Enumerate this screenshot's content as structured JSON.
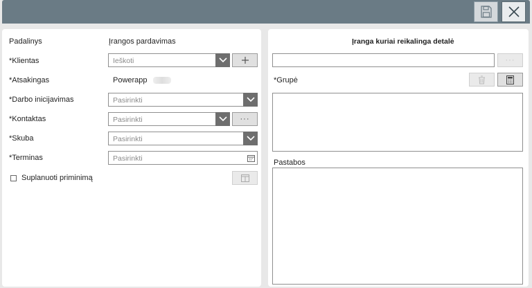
{
  "toolbar": {
    "save_icon": "save-icon",
    "close_icon": "close-icon"
  },
  "left": {
    "padalinys_label": "Padalinys",
    "padalinys_value": "Įrangos pardavimas",
    "klientas_label": "*Klientas",
    "klientas_placeholder": "Ieškoti",
    "atsakingas_label": "*Atsakingas",
    "atsakingas_value": "Powerapp",
    "darbo_label": "*Darbo inicijavimas",
    "darbo_placeholder": "Pasirinkti",
    "kontaktas_label": "*Kontaktas",
    "kontaktas_placeholder": "Pasirinkti",
    "kontaktas_more": "···",
    "skuba_label": "*Skuba",
    "skuba_placeholder": "Pasirinkti",
    "terminas_label": "*Terminas",
    "terminas_placeholder": "Pasirinkti",
    "priminimas_label": "Suplanuoti priminimą"
  },
  "right": {
    "title": "Įranga kuriai reikalinga detalė",
    "search_more": "···",
    "grupe_label": "*Grupė",
    "pastabos_label": "Pastabos"
  }
}
